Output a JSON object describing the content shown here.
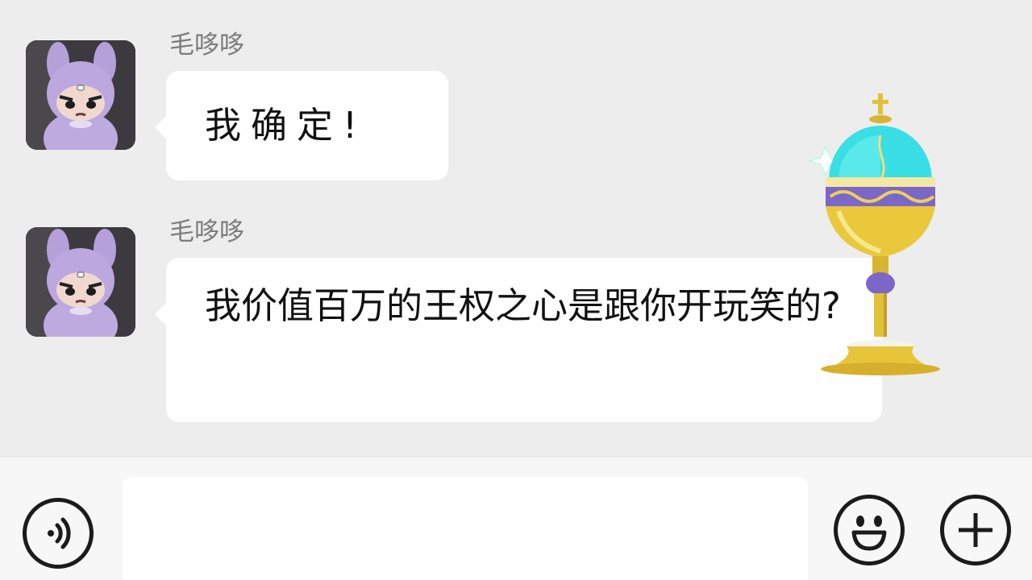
{
  "chat": {
    "messages": [
      {
        "sender": "毛哆哆",
        "text": "我确定!"
      },
      {
        "sender": "毛哆哆",
        "text": "我价值百万的王权之心是跟你开玩笑的?"
      }
    ]
  },
  "sticker": {
    "icon": "golden-chalice-sticker"
  },
  "input_bar": {
    "voice_icon": "voice-icon",
    "emoji_icon": "emoji-icon",
    "plus_icon": "plus-icon",
    "input_value": ""
  },
  "colors": {
    "background": "#ededed",
    "bubble": "#ffffff",
    "avatar_purple": "#b9a2dc",
    "chalice_gold": "#e8c63a",
    "chalice_globe": "#38e0e6"
  }
}
